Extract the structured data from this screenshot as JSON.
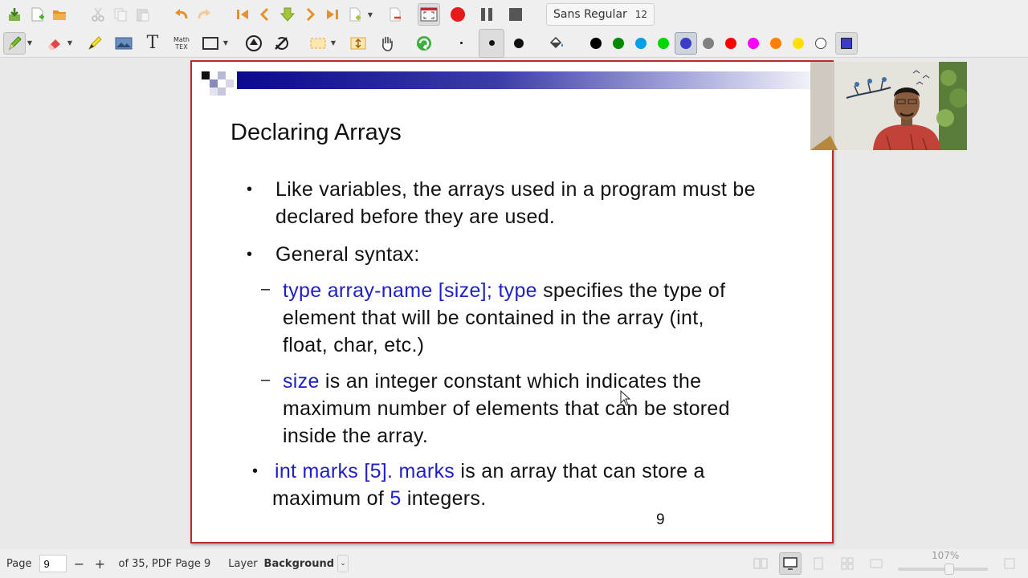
{
  "toolbar_font": {
    "name": "Sans Regular",
    "size": "12"
  },
  "colors": {
    "pen_palette": [
      "#000000",
      "#008a00",
      "#00a0e6",
      "#00d800",
      "#3c3cc8",
      "#808080",
      "#ff0000",
      "#ff00ff",
      "#ff8000",
      "#ffe000",
      "#ffffff"
    ],
    "accent": "#c0282d",
    "slide_blue": "#1f1fc8"
  },
  "icons": {
    "toolbar1": [
      "save-icon",
      "new-page-icon",
      "open-icon",
      "cut-icon",
      "copy-icon",
      "paste-icon",
      "undo-icon",
      "redo-icon",
      "first-page-icon",
      "previous-page-icon",
      "goto-page-icon",
      "next-page-icon",
      "last-page-icon",
      "new-page-after-icon",
      "delete-page-icon",
      "fullscreen-icon",
      "record-icon",
      "pause-icon",
      "stop-icon"
    ],
    "toolbar2": [
      "pen-icon",
      "eraser-icon",
      "highlighter-icon",
      "image-icon",
      "text-icon",
      "math-tex-icon",
      "rectangle-icon",
      "shape-recognizer-icon",
      "ruler-icon",
      "select-rect-icon",
      "vertical-space-icon",
      "hand-icon",
      "refresh-icon",
      "dot-small-icon",
      "dot-medium-icon",
      "dot-large-icon",
      "fill-icon"
    ]
  },
  "toolbar": {
    "math_label_top": "Math",
    "math_label_bottom": "TEX",
    "text_tool": "T"
  },
  "slide": {
    "title": "Declaring Arrays",
    "bullet1_line1": "Like variables, the arrays used in a program must be",
    "bullet1_line2": "declared before they are used.",
    "bullet2": "General syntax:",
    "sub1_blue": "type array-name [size]; type",
    "sub1_rest": " specifies the type of",
    "sub1_line2": "element that will be contained in the array (int,",
    "sub1_line3": "float, char, etc.)",
    "sub2_blue": "size",
    "sub2_rest": " is an integer constant which indicates the",
    "sub2_line2": "maximum number of elements that can be stored",
    "sub2_line3": "inside the array.",
    "bullet3_blue": "int  marks [5]. marks",
    "bullet3_rest": " is an array that can store a",
    "bullet3_line2_a": "maximum of ",
    "bullet3_line2_num": "5",
    "bullet3_line2_b": " integers.",
    "page_number": "9",
    "bullet_char": "•",
    "dash_char": "–"
  },
  "status": {
    "page_label": "Page",
    "page_value": "9",
    "minus": "−",
    "plus": "+",
    "page_of": "of 35, PDF Page 9",
    "layer_label": "Layer",
    "layer_value": "Background",
    "zoom": "107%",
    "zoom_fraction": 0.58
  }
}
